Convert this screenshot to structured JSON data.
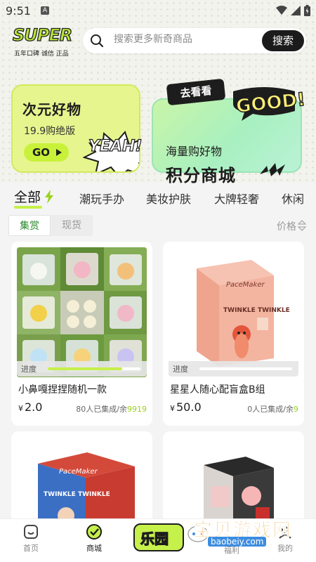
{
  "status_bar": {
    "time": "9:51",
    "notification_letter": "A"
  },
  "header": {
    "logo_word": "SUPER",
    "logo_tagline": "五年口碑 诚信 正品",
    "search_placeholder": "搜索更多新奇商品",
    "search_button": "搜索"
  },
  "banners": {
    "left": {
      "title": "次元好物",
      "subtitle": "19.9购绝版",
      "go_label": "GO",
      "sticker": "YEAH!"
    },
    "right": {
      "tag": "去看看",
      "sticker": "GOOD!",
      "line1": "海量购好物",
      "line2": "积分商城"
    }
  },
  "category_tabs": [
    {
      "label": "全部",
      "active": true
    },
    {
      "label": "潮玩手办",
      "active": false
    },
    {
      "label": "美妆护肤",
      "active": false
    },
    {
      "label": "大牌轻奢",
      "active": false
    },
    {
      "label": "休闲",
      "active": false
    }
  ],
  "sub_tabs": {
    "first": "集赏",
    "second": "现货"
  },
  "sort": {
    "label": "价格"
  },
  "products": [
    {
      "title": "小鼻嘎捏捏随机一款",
      "currency": "¥",
      "price": "2.0",
      "progress_label": "进度",
      "progress": 0.8,
      "stock_prefix": "80人已集成/余",
      "stock_remaining": "9919"
    },
    {
      "title": "星星人随心配盲盒B组",
      "currency": "¥",
      "price": "50.0",
      "progress_label": "进度",
      "progress": 0.0,
      "stock_prefix": "0人已集成/余",
      "stock_remaining": "9"
    },
    {
      "title": "",
      "currency": "",
      "price": "",
      "progress_label": "",
      "progress": 0,
      "stock_prefix": "",
      "stock_remaining": ""
    },
    {
      "title": "",
      "currency": "",
      "price": "",
      "progress_label": "",
      "progress": 0,
      "stock_prefix": "",
      "stock_remaining": ""
    }
  ],
  "box_art": {
    "brand": "PaceMaker",
    "line": "TWINKLE TWINKLE"
  },
  "bottom_nav": {
    "home": "首页",
    "mall": "商城",
    "center": "乐园",
    "discover": "福利",
    "mine": "我的"
  },
  "watermark": {
    "text": "宝贝游戏网",
    "url": "baobeiy.com"
  },
  "colors": {
    "accent_lime": "#c6f04a",
    "price_green": "#9ad11e",
    "subtab_green": "#2c8a2c"
  }
}
